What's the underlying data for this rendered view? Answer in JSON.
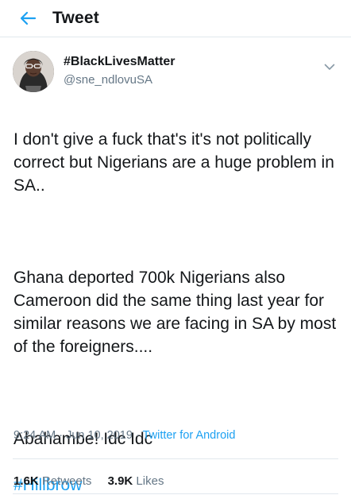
{
  "header": {
    "title": "Tweet",
    "back_icon": "arrow-left-icon"
  },
  "colors": {
    "accent": "#1da1f2",
    "text": "#14171a",
    "muted": "#657786",
    "divider": "#e1e8ed"
  },
  "tweet": {
    "author": {
      "display_name": "#BlackLivesMatter",
      "handle": "@sne_ndlovuSA",
      "avatar_icon": "avatar"
    },
    "caret_icon": "chevron-down-icon",
    "paragraphs": [
      "I don't give a fuck that's it's not politically correct but Nigerians are a huge problem in SA..",
      "Ghana deported 700k Nigerians also Cameroon did the same thing last year for similar reasons we are facing in SA by most of the foreigners....",
      "Abahambe! Idc Idc"
    ],
    "hashtag": "#Hillbrow",
    "timestamp": "9:24 AM · Jun 10, 2019 · ",
    "source": "Twitter for Android",
    "retweets_count": "1.6K",
    "retweets_label": "Retweets",
    "likes_count": "3.9K",
    "likes_label": "Likes"
  }
}
